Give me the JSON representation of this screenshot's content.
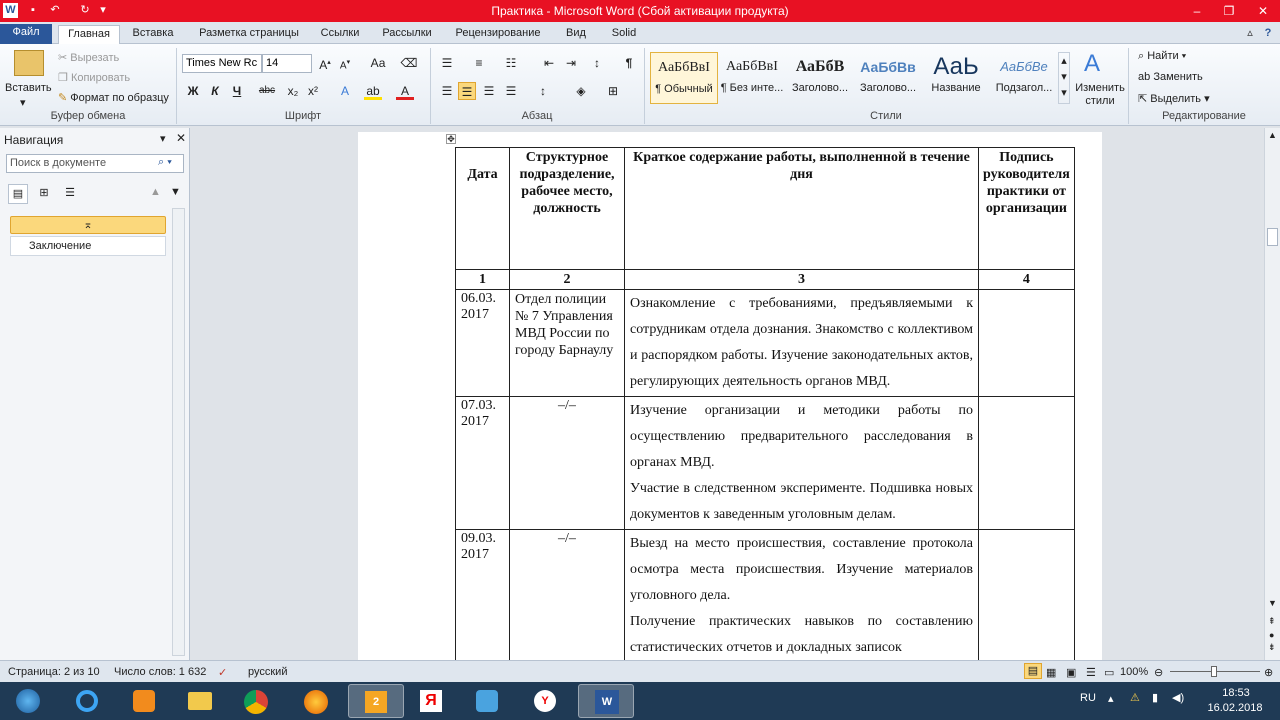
{
  "window": {
    "title": "Практика - Microsoft Word (Сбой активации продукта)",
    "app_icon": "W"
  },
  "tabs": [
    "Файл",
    "Главная",
    "Вставка",
    "Разметка страницы",
    "Ссылки",
    "Рассылки",
    "Рецензирование",
    "Вид",
    "Solid"
  ],
  "ribbon": {
    "clipboard": {
      "paste": "Вставить",
      "cut": "Вырезать",
      "copy": "Копировать",
      "format_painter": "Формат по образцу",
      "label": "Буфер обмена"
    },
    "font": {
      "name": "Times New Rc",
      "size": "14",
      "label": "Шрифт",
      "bold": "Ж",
      "italic": "К",
      "underline": "Ч",
      "case": "Аа"
    },
    "paragraph": {
      "label": "Абзац"
    },
    "styles": {
      "label": "Стили",
      "items": [
        {
          "preview": "АаБбВвI",
          "name": "¶ Обычный"
        },
        {
          "preview": "АаБбВвI",
          "name": "¶ Без инте..."
        },
        {
          "preview": "АаБбВ",
          "name": "Заголово..."
        },
        {
          "preview": "АаБбВв",
          "name": "Заголово..."
        },
        {
          "preview": "АаЬ",
          "name": "Название"
        },
        {
          "preview": "АаБбВе",
          "name": "Подзагол..."
        }
      ],
      "change": "Изменить стили"
    },
    "editing": {
      "label": "Редактирование",
      "find": "Найти",
      "replace": "Заменить",
      "select": "Выделить"
    }
  },
  "nav": {
    "title": "Навигация",
    "search_placeholder": "Поиск в документе",
    "headings": [
      "Заключение"
    ]
  },
  "table": {
    "headers": [
      "Дата",
      "Структурное подразделение, рабочее место, должность",
      "Краткое содержание работы, выполненной в течение дня",
      "Подпись руководителя практики от организации"
    ],
    "numbers": [
      "1",
      "2",
      "3",
      "4"
    ],
    "rows": [
      {
        "date": "06.03. 2017",
        "unit": "Отдел полиции № 7 Управления МВД России по городу Барнаулу",
        "content": [
          "Ознакомление с требованиями, предъявляемыми к сотрудникам отдела дознания. Знакомство с коллективом и распорядком работы. Изучение законодательных актов, регулирующих деятельность органов МВД."
        ]
      },
      {
        "date": "07.03. 2017",
        "unit": "–/–",
        "content": [
          "Изучение организации и методики работы по осуществлению предварительного расследования в органах МВД.",
          "Участие в следственном эксперименте. Подшивка новых документов к заведенным уголовным делам."
        ]
      },
      {
        "date": "09.03. 2017",
        "unit": "–/–",
        "content": [
          "Выезд на место происшествия, составление протокола осмотра места происшествия. Изучение материалов уголовного дела.",
          "Получение практических навыков по составлению статистических отчетов и докладных записок"
        ]
      }
    ]
  },
  "status": {
    "page": "Страница: 2 из 10",
    "words": "Число слов: 1 632",
    "language": "русский",
    "zoom": "100%"
  },
  "taskbar": {
    "lang": "RU",
    "time": "18:53",
    "date": "16.02.2018"
  }
}
